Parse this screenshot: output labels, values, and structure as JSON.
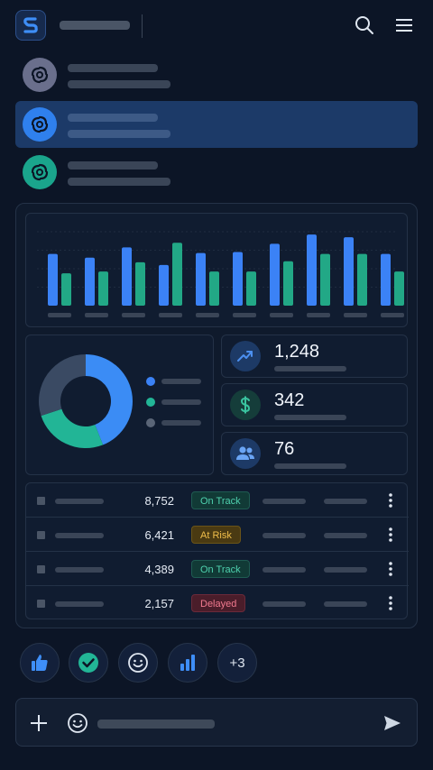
{
  "app": {
    "logo_icon": "s-logo-icon"
  },
  "header": {
    "search_icon": "search-icon",
    "menu_icon": "hamburger-menu-icon"
  },
  "conversations": [
    {
      "avatar_color": "#6a6f8c",
      "active": false
    },
    {
      "avatar_color": "#2f80ed",
      "active": true
    },
    {
      "avatar_color": "#1aa58c",
      "active": false
    }
  ],
  "bar_chart": {
    "type": "bar",
    "categories_count": 10,
    "series": [
      {
        "color": "#3b82f6",
        "values": [
          56,
          52,
          63,
          44,
          57,
          58,
          67,
          77,
          74,
          56
        ]
      },
      {
        "color": "#22a886",
        "values": [
          35,
          37,
          47,
          68,
          37,
          37,
          48,
          56,
          56,
          37
        ]
      }
    ]
  },
  "donut": {
    "segments": [
      {
        "color": "#3b8cf5",
        "value": 44
      },
      {
        "color": "#22b596",
        "value": 26
      },
      {
        "color": "#3a4a63",
        "value": 30
      }
    ],
    "legend_colors": [
      "#3b82f6",
      "#22b596",
      "#5a6577"
    ]
  },
  "stats": [
    {
      "value": "1,248",
      "icon": "trending-up-icon",
      "bg": "#1d3a66",
      "fg": "#4c90f0"
    },
    {
      "value": "342",
      "icon": "dollar-icon",
      "bg": "#153d3a",
      "fg": "#3ac4a0"
    },
    {
      "value": "76",
      "icon": "users-icon",
      "bg": "#1d3a66",
      "fg": "#6aa5f5"
    }
  ],
  "table": {
    "rows": [
      {
        "value": "8,752",
        "status": "On Track",
        "kind": "ok"
      },
      {
        "value": "6,421",
        "status": "At Risk",
        "kind": "risk"
      },
      {
        "value": "4,389",
        "status": "On Track",
        "kind": "ok"
      },
      {
        "value": "2,157",
        "status": "Delayed",
        "kind": "late"
      }
    ]
  },
  "reactions": {
    "items": [
      "thumbs-up-icon",
      "check-circle-icon",
      "smiley-icon",
      "bar-chart-icon"
    ],
    "more_label": "+3"
  },
  "composer": {
    "add_icon": "plus-icon",
    "emoji_icon": "emoji-icon",
    "send_icon": "send-icon"
  }
}
